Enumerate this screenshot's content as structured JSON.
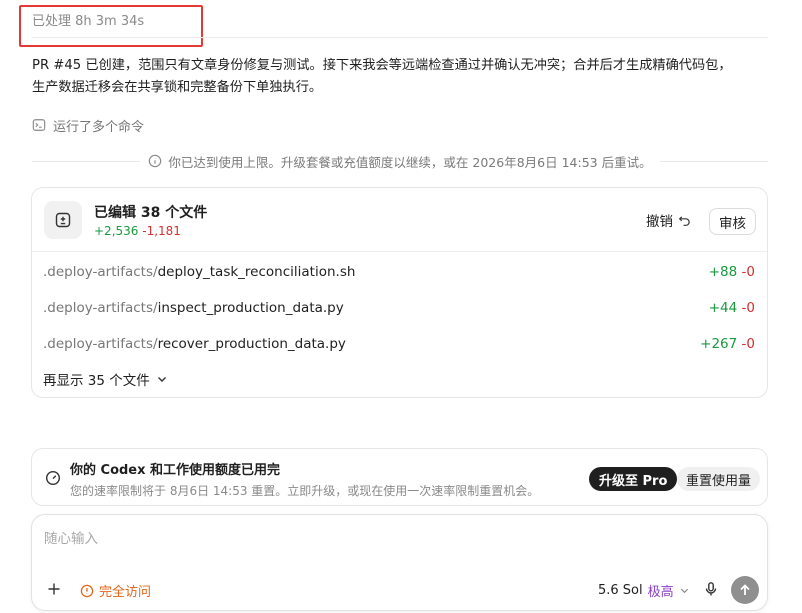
{
  "header": {
    "processed_time": "已处理 8h 3m 34s"
  },
  "message": {
    "line1": "PR #45 已创建，范围只有文章身份修复与测试。接下来我会等远端检查通过并确认无冲突；合并后才生成精确代码包，",
    "line2": "生产数据迁移会在共享锁和完整备份下单独执行。"
  },
  "commands": {
    "label": "运行了多个命令",
    "icon": "terminal-icon"
  },
  "limit_notice": {
    "text": "你已达到使用上限。升级套餐或充值额度以继续，或在 2026年8月6日 14:53 后重试。",
    "icon": "info-icon"
  },
  "files": {
    "title": "已编辑 38 个文件",
    "added": "+2,536",
    "removed": "-1,181",
    "undo_label": "撤销",
    "review_label": "审核",
    "items": [
      {
        "dir": ".deploy-artifacts/",
        "name": "deploy_task_reconciliation.sh",
        "added": "+88",
        "removed": "-0"
      },
      {
        "dir": ".deploy-artifacts/",
        "name": "inspect_production_data.py",
        "added": "+44",
        "removed": "-0"
      },
      {
        "dir": ".deploy-artifacts/",
        "name": "recover_production_data.py",
        "added": "+267",
        "removed": "-0"
      }
    ],
    "show_more": "再显示 35 个文件"
  },
  "usage": {
    "title": "你的 Codex 和工作使用额度已用完",
    "subtitle": "您的速率限制将于 8月6日 14:53 重置。立即升级，或现在使用一次速率限制重置机会。",
    "upgrade_label": "升级至 Pro",
    "reset_label": "重置使用量"
  },
  "composer": {
    "placeholder": "随心输入",
    "access_label": "完全访问",
    "model": "5.6 Sol",
    "effort": "极高"
  },
  "colors": {
    "added": "#1a9a3f",
    "removed": "#d32f2f",
    "access": "#e0671b",
    "effort": "#8b3fc7",
    "highlight": "#e53935"
  }
}
